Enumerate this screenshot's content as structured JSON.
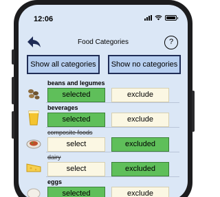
{
  "status_bar": {
    "time": "12:06"
  },
  "navbar": {
    "title": "Food Categories",
    "help_label": "?"
  },
  "buttons": {
    "show_all": "Show all categories",
    "show_none": "Show no categories"
  },
  "categories": [
    {
      "name": "beans and legumes",
      "enabled": true,
      "select_label": "selected",
      "exclude_label": "exclude"
    },
    {
      "name": "beverages",
      "enabled": true,
      "select_label": "selected",
      "exclude_label": "exclude"
    },
    {
      "name": "composite foods",
      "enabled": false,
      "select_label": "select",
      "exclude_label": "excluded"
    },
    {
      "name": "dairy",
      "enabled": false,
      "select_label": "select",
      "exclude_label": "excluded"
    },
    {
      "name": "eggs",
      "enabled": true,
      "select_label": "selected",
      "exclude_label": "exclude"
    }
  ],
  "icons": {
    "back": "back-arrow-icon",
    "help": "help-icon",
    "images": [
      "beans-icon",
      "beverage-icon",
      "composite-food-icon",
      "dairy-icon",
      "egg-icon"
    ]
  }
}
